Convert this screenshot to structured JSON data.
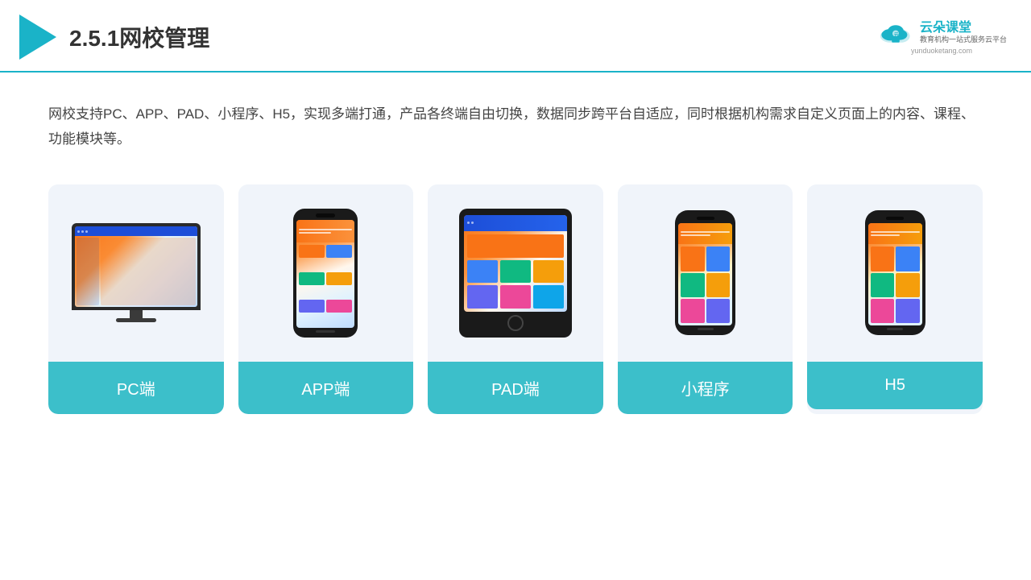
{
  "header": {
    "title": "2.5.1网校管理",
    "brand": {
      "name": "云朵课堂",
      "slogan": "教育机构一站式服务云平台",
      "url": "yunduoketang.com"
    }
  },
  "description": "网校支持PC、APP、PAD、小程序、H5，实现多端打通，产品各终端自由切换，数据同步跨平台自适应，同时根据机构需求自定义页面上的内容、课程、功能模块等。",
  "devices": [
    {
      "label": "PC端",
      "type": "pc"
    },
    {
      "label": "APP端",
      "type": "phone"
    },
    {
      "label": "PAD端",
      "type": "tablet"
    },
    {
      "label": "小程序",
      "type": "miniphone"
    },
    {
      "label": "H5",
      "type": "miniphone2"
    }
  ],
  "colors": {
    "teal": "#3cbfca",
    "accent": "#1ab3c8"
  }
}
